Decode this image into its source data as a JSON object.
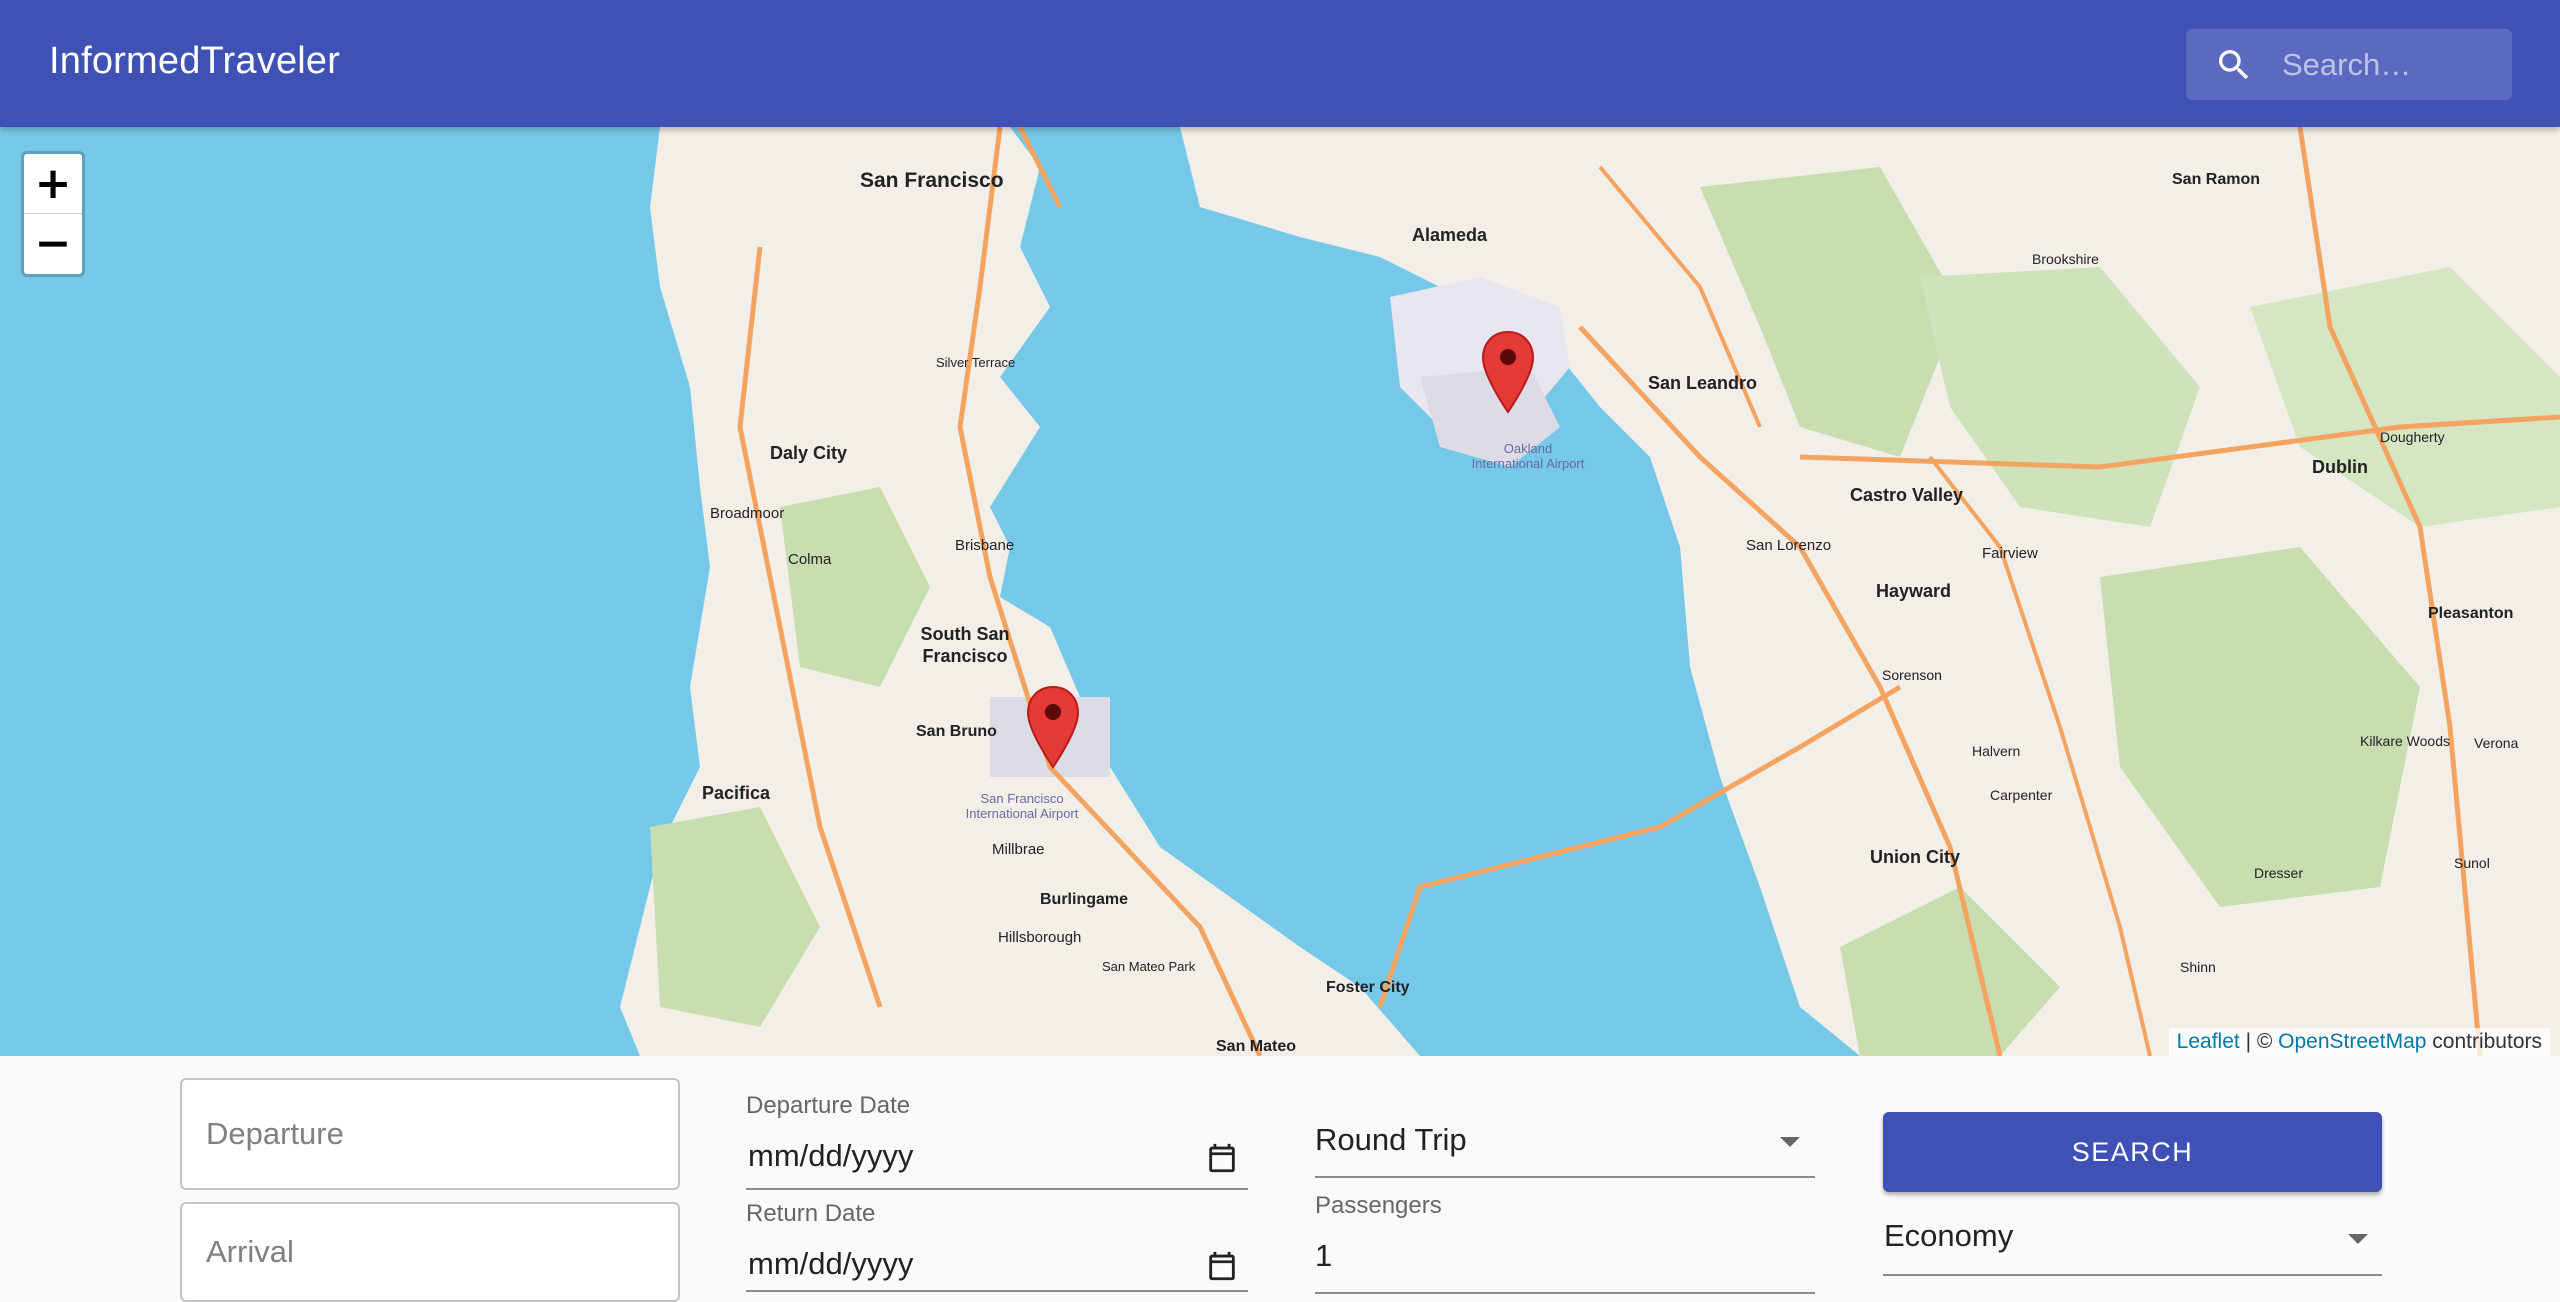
{
  "app": {
    "title": "InformedTraveler"
  },
  "search": {
    "placeholder": "Search…"
  },
  "map": {
    "zoom_in": "+",
    "zoom_out": "−",
    "attribution": {
      "leaflet": "Leaflet",
      "separator": "| ©",
      "osm": "OpenStreetMap",
      "suffix": "contributors"
    },
    "labels": {
      "san_francisco": "San Francisco",
      "alameda": "Alameda",
      "san_leandro": "San Leandro",
      "daly_city": "Daly City",
      "brisbane": "Brisbane",
      "south_sf": "South San Francisco",
      "san_bruno": "San Bruno",
      "pacifica": "Pacifica",
      "millbrae": "Millbrae",
      "burlingame": "Burlingame",
      "hillsborough": "Hillsborough",
      "foster_city": "Foster City",
      "san_mateo": "San Mateo",
      "castro_valley": "Castro Valley",
      "hayward": "Hayward",
      "union_city": "Union City",
      "dublin": "Dublin",
      "pleasanton": "Pleasanton",
      "san_ramon": "San Ramon",
      "san_lorenzo": "San Lorenzo",
      "colma": "Colma",
      "broadmoor": "Broadmoor",
      "oakland_airport": "Oakland International Airport",
      "sfo_airport": "San Francisco International Airport",
      "fairview": "Fairview",
      "sorenson": "Sorenson",
      "halvern": "Halvern",
      "carpenter": "Carpenter",
      "brookshire": "Brookshire",
      "dougherty": "Dougherty",
      "verona": "Verona",
      "sunol": "Sunol",
      "dresser": "Dresser",
      "shinn": "Shinn",
      "kilkare_woods": "Kilkare Woods",
      "silver_terrace": "Silver Terrace",
      "san_mateo_park": "San Mateo Park"
    }
  },
  "form": {
    "departure_placeholder": "Departure",
    "arrival_placeholder": "Arrival",
    "departure_date_label": "Departure Date",
    "departure_date_value": "mm/dd/yyyy",
    "return_date_label": "Return Date",
    "return_date_value": "mm/dd/yyyy",
    "trip_type": "Round Trip",
    "passengers_label": "Passengers",
    "passengers_value": "1",
    "search_button": "SEARCH",
    "cabin_class": "Economy"
  },
  "colors": {
    "primary": "#3f51b5",
    "water": "#76c8e8",
    "land": "#f2efe9",
    "marker": "#e53935"
  }
}
